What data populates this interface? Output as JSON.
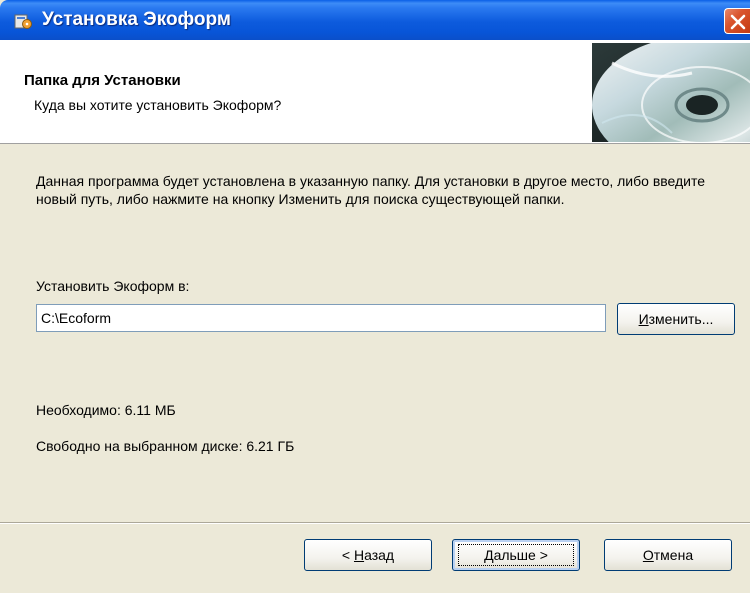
{
  "window": {
    "title": "Установка Экоформ",
    "close_icon": "close-icon",
    "app_icon": "installer-icon"
  },
  "header": {
    "title": "Папка для Установки",
    "subtitle": "Куда вы хотите установить Экоформ?",
    "image_icon": "cd-disc-icon"
  },
  "body": {
    "description": "Данная программа будет установлена в указанную папку. Для установки в другое место, либо введите новый путь, либо нажмите на кнопку Изменить для поиска существующей папки.",
    "install_label": "Установить Экоформ в:",
    "path_value": "C:\\Ecoform",
    "change_button": {
      "underline": "И",
      "rest": "зменить..."
    },
    "space_required": "Необходимо: 6.11 МБ",
    "space_free": "Свободно на выбранном диске: 6.21 ГБ"
  },
  "footer": {
    "back": {
      "prefix": "< ",
      "underline": "Н",
      "rest": "азад"
    },
    "next": {
      "underline": "Д",
      "rest": "альше >"
    },
    "cancel": {
      "underline": "О",
      "rest": "тмена"
    }
  },
  "colors": {
    "titlebar": "#0A5FE6",
    "dialog_bg": "#ECE9D8",
    "close_button": "#D9542E"
  }
}
